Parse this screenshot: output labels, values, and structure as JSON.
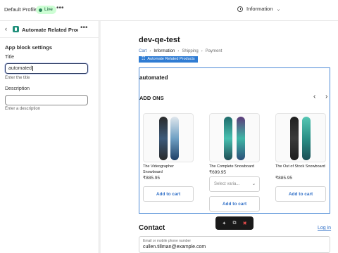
{
  "topbar": {
    "profile": "Default Profile",
    "live_badge": "Live",
    "more_label": "•••",
    "page_select": "Information"
  },
  "sidebar": {
    "back": "‹",
    "app_title": "Automate Related Prod...",
    "more_label": "•••",
    "section_title": "App block settings",
    "title_field": {
      "label": "Title",
      "value": "automated",
      "hint": "Enter the title"
    },
    "description_field": {
      "label": "Description",
      "value": "",
      "hint": "Enter a description"
    }
  },
  "preview": {
    "store_name": "dev-qe-test",
    "breadcrumb": [
      "Cart",
      "Information",
      "Shipping",
      "Payment"
    ],
    "breadcrumb_sep": "›",
    "app_badge": "Automate Related Products",
    "block_heading": "automated",
    "addons_title": "ADD ONS",
    "prev_arrow": "‹",
    "next_arrow": "›",
    "products": [
      {
        "name": "The Videographer Snowboard",
        "price": "₹885.95",
        "variant": null,
        "button": "Add to cart"
      },
      {
        "name": "The Complete Snowboard",
        "price": "₹699.95",
        "variant": "Select varia...",
        "button": "Add to cart"
      },
      {
        "name": "The Out of Stock Snowboard",
        "price": "₹885.95",
        "variant": null,
        "button": "Add to cart"
      }
    ],
    "contact_title": "Contact",
    "login_link": "Log in",
    "email_label": "Email or mobile phone number",
    "email_value": "cullen.tillman@example.com"
  },
  "colors": {
    "accent": "#2f7cd3",
    "live_bg": "#cdfed4",
    "toolbar_bg": "#1a1a1a",
    "delete": "#e44b4b"
  },
  "icons": {
    "toolbar": [
      "magic-wand-icon",
      "duplicate-icon",
      "delete-icon"
    ]
  }
}
